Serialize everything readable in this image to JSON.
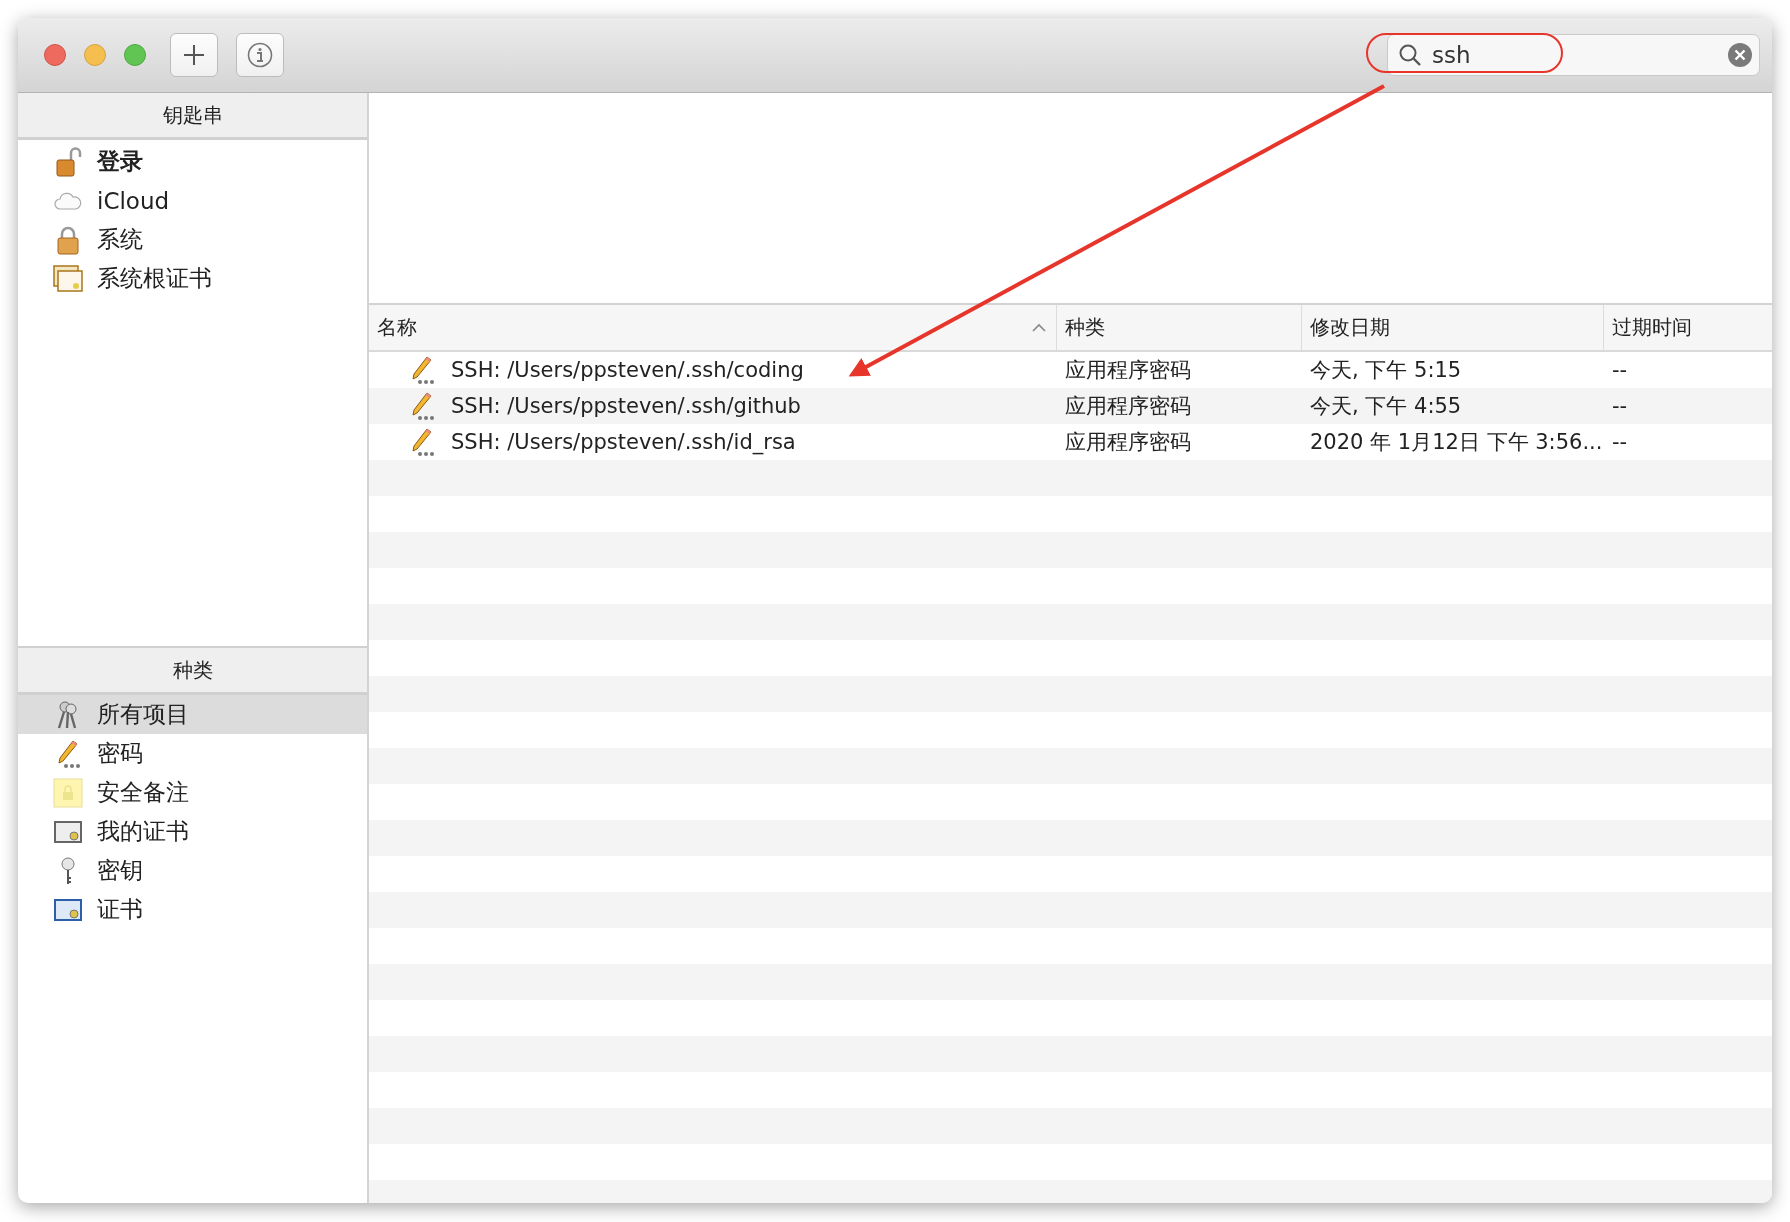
{
  "window": {
    "search": {
      "value": "ssh"
    }
  },
  "sidebar": {
    "keychains": {
      "title": "钥匙串",
      "items": [
        {
          "label": "登录",
          "kind": "unlocked",
          "default_keychain": true
        },
        {
          "label": "iCloud",
          "kind": "cloud",
          "default_keychain": false
        },
        {
          "label": "系统",
          "kind": "locked",
          "default_keychain": false
        },
        {
          "label": "系统根证书",
          "kind": "certstack",
          "default_keychain": false
        }
      ]
    },
    "categories": {
      "title": "种类",
      "items": [
        {
          "label": "所有项目",
          "kind": "keys",
          "selected": true
        },
        {
          "label": "密码",
          "kind": "password",
          "selected": false
        },
        {
          "label": "安全备注",
          "kind": "note",
          "selected": false
        },
        {
          "label": "我的证书",
          "kind": "mycert",
          "selected": false
        },
        {
          "label": "密钥",
          "kind": "key",
          "selected": false
        },
        {
          "label": "证书",
          "kind": "cert",
          "selected": false
        }
      ]
    }
  },
  "table": {
    "columns": [
      "名称",
      "种类",
      "修改日期",
      "过期时间"
    ],
    "rows": [
      {
        "name": "SSH: /Users/ppsteven/.ssh/coding",
        "kind": "应用程序密码",
        "modified": "今天, 下午 5:15",
        "expires": "--"
      },
      {
        "name": "SSH: /Users/ppsteven/.ssh/github",
        "kind": "应用程序密码",
        "modified": "今天, 下午 4:55",
        "expires": "--"
      },
      {
        "name": "SSH: /Users/ppsteven/.ssh/id_rsa",
        "kind": "应用程序密码",
        "modified": "2020 年 1月12日 下午 3:56...",
        "expires": "--"
      }
    ]
  }
}
